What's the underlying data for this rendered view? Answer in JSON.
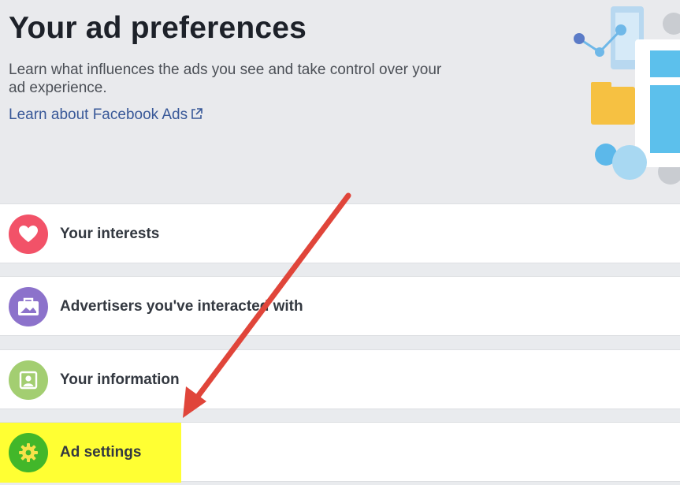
{
  "header": {
    "title": "Your ad preferences",
    "description": "Learn what influences the ads you see and take control over your ad experience.",
    "learn_link": "Learn about Facebook Ads",
    "link_icon": "external-link-icon"
  },
  "rows": [
    {
      "label": "Your interests",
      "icon": "heart-icon",
      "color": "#f25268"
    },
    {
      "label": "Advertisers you've interacted with",
      "icon": "briefcase-icon",
      "color": "#8c72cb"
    },
    {
      "label": "Your information",
      "icon": "profile-icon",
      "color": "#a3ce71"
    },
    {
      "label": "Ad settings",
      "icon": "gear-icon",
      "color": "#42b72a",
      "highlight": "#ffff33"
    }
  ],
  "annotation": {
    "arrow_color": "#e0453a"
  }
}
